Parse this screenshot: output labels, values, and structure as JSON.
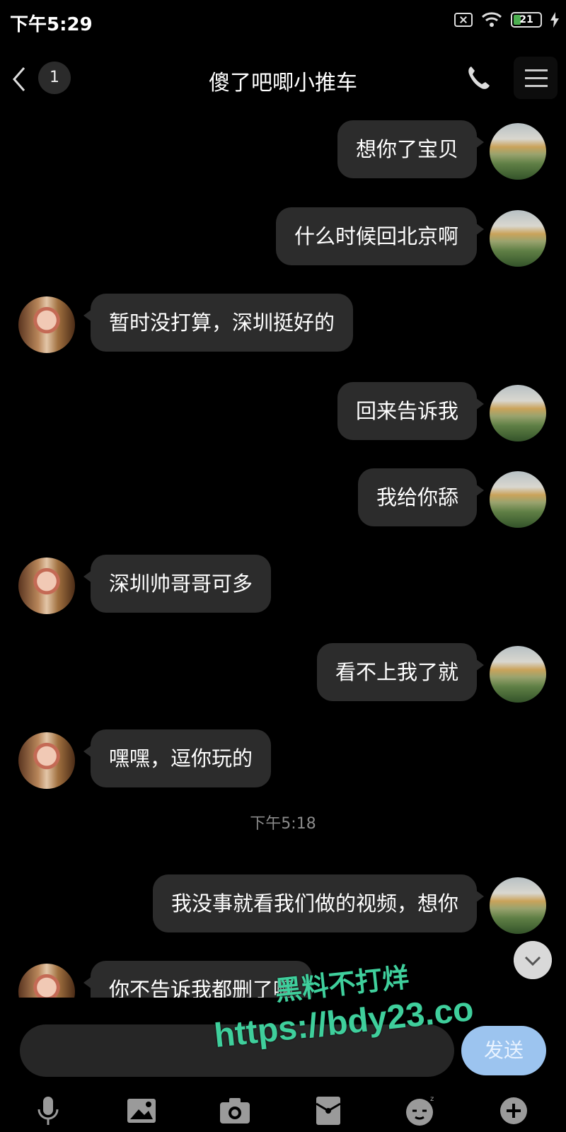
{
  "status_bar": {
    "time": "下午5:29",
    "battery": "21"
  },
  "header": {
    "title": "傻了吧唧小推车",
    "unread_count": "1"
  },
  "messages": [
    {
      "side": "right",
      "text": "想你了宝贝"
    },
    {
      "side": "right",
      "text": "什么时候回北京啊"
    },
    {
      "side": "left",
      "text": "暂时没打算，深圳挺好的"
    },
    {
      "side": "right",
      "text": "回来告诉我"
    },
    {
      "side": "right",
      "text": "我给你舔"
    },
    {
      "side": "left",
      "text": "深圳帅哥哥可多"
    },
    {
      "side": "right",
      "text": "看不上我了就"
    },
    {
      "side": "left",
      "text": "嘿嘿，逗你玩的"
    },
    {
      "side": "right",
      "text": "我没事就看我们做的视频，想你"
    },
    {
      "side": "left",
      "text": "你不告诉我都删了啊"
    }
  ],
  "timestamp": "下午5:18",
  "input": {
    "send_label": "发送"
  },
  "watermark": {
    "line1": "黑料不打烊",
    "line2": "https://bdy23.co"
  },
  "toolbar": [
    "microphone-icon",
    "image-icon",
    "camera-icon",
    "red-packet-icon",
    "emoji-icon",
    "add-icon"
  ]
}
